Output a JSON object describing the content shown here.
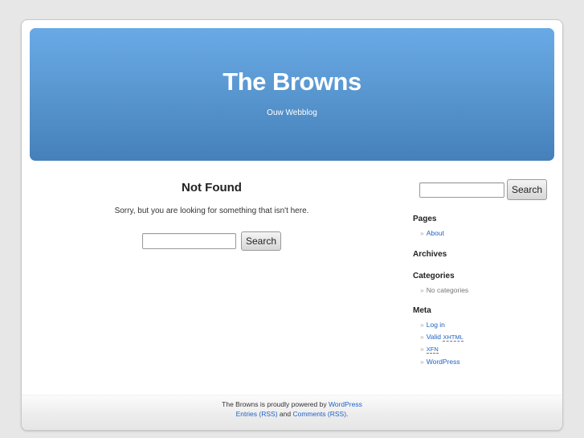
{
  "header": {
    "title": "The Browns",
    "description": "Ouw Webblog"
  },
  "main": {
    "heading": "Not Found",
    "message": "Sorry, but you are looking for something that isn't here.",
    "search": {
      "value": "",
      "button_label": "Search"
    }
  },
  "sidebar": {
    "search": {
      "value": "",
      "button_label": "Search"
    },
    "bullet": "»",
    "pages": {
      "title": "Pages",
      "items": [
        {
          "label": "About"
        }
      ]
    },
    "archives": {
      "title": "Archives"
    },
    "categories": {
      "title": "Categories",
      "empty_text": "No categories"
    },
    "meta": {
      "title": "Meta",
      "items": [
        {
          "label": "Log in"
        },
        {
          "prefix": "Valid ",
          "abbr": "XHTML"
        },
        {
          "abbr": "XFN"
        },
        {
          "label": "WordPress"
        }
      ]
    }
  },
  "footer": {
    "line1_text": "The Browns is proudly powered by ",
    "line1_link": "WordPress",
    "entries_link": "Entries (RSS)",
    "and_text": " and ",
    "comments_link": "Comments (RSS)",
    "end_text": "."
  },
  "colors": {
    "link": "#2262c4",
    "header_top": "#69aae6",
    "header_bottom": "#4580ba",
    "background": "#e7e7e7"
  }
}
